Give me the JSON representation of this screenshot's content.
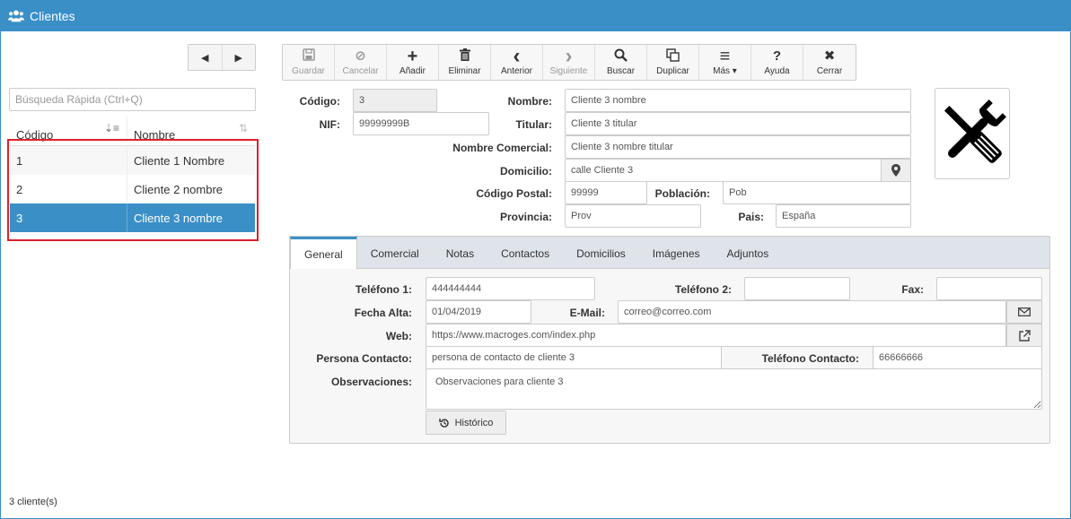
{
  "window": {
    "title": "Clientes",
    "icon": "users-icon"
  },
  "nav": {
    "prev_icon": "◀",
    "next_icon": "▶"
  },
  "search": {
    "placeholder": "Búsqueda Rápida (Ctrl+Q)",
    "value": ""
  },
  "grid": {
    "columns": [
      "Código",
      "Nombre"
    ],
    "rows": [
      {
        "codigo": "1",
        "nombre": "Cliente 1 Nombre"
      },
      {
        "codigo": "2",
        "nombre": "Cliente 2 nombre"
      },
      {
        "codigo": "3",
        "nombre": "Cliente 3 nombre"
      }
    ],
    "selected_row": "3"
  },
  "footer": {
    "count": "3 cliente(s)"
  },
  "toolbar": {
    "buttons": [
      {
        "label": "Guardar",
        "icon": "save-icon",
        "glyph": "🖫",
        "enabled": false
      },
      {
        "label": "Cancelar",
        "icon": "cancel-icon",
        "glyph": "⊘",
        "enabled": false
      },
      {
        "label": "Añadir",
        "icon": "plus-icon",
        "glyph": "+",
        "enabled": true
      },
      {
        "label": "Eliminar",
        "icon": "trash-icon",
        "glyph": "🗑",
        "enabled": true
      },
      {
        "label": "Anterior",
        "icon": "chevron-left-icon",
        "glyph": "‹",
        "enabled": true
      },
      {
        "label": "Siguiente",
        "icon": "chevron-right-icon",
        "glyph": "›",
        "enabled": false
      },
      {
        "label": "Buscar",
        "icon": "search-icon",
        "glyph": "⚲",
        "enabled": true
      },
      {
        "label": "Duplicar",
        "icon": "duplicate-icon",
        "glyph": "❐",
        "enabled": true
      },
      {
        "label": "Más ▾",
        "icon": "menu-icon",
        "glyph": "≡",
        "enabled": true
      },
      {
        "label": "Ayuda",
        "icon": "help-icon",
        "glyph": "?",
        "enabled": true
      },
      {
        "label": "Cerrar",
        "icon": "close-icon",
        "glyph": "✖",
        "enabled": true
      }
    ]
  },
  "form": {
    "codigo": {
      "label": "Código:",
      "value": "3"
    },
    "nif": {
      "label": "NIF:",
      "value": "99999999B"
    },
    "nombre": {
      "label": "Nombre:",
      "value": "Cliente 3 nombre"
    },
    "titular": {
      "label": "Titular:",
      "value": "Cliente 3 titular"
    },
    "nombre_comercial": {
      "label": "Nombre Comercial:",
      "value": "Cliente 3 nombre titular"
    },
    "domicilio": {
      "label": "Domicilio:",
      "value": "calle Cliente 3"
    },
    "codigo_postal": {
      "label": "Código Postal:",
      "value": "99999"
    },
    "poblacion": {
      "label": "Población:",
      "value": "Pob"
    },
    "provincia": {
      "label": "Provincia:",
      "value": "Prov"
    },
    "pais": {
      "label": "Pais:",
      "value": "España"
    }
  },
  "tabs": {
    "items": [
      "General",
      "Comercial",
      "Notas",
      "Contactos",
      "Domicilios",
      "Imágenes",
      "Adjuntos"
    ],
    "active": "General"
  },
  "general": {
    "telefono1": {
      "label": "Teléfono 1:",
      "value": "444444444"
    },
    "telefono2": {
      "label": "Teléfono 2:",
      "value": ""
    },
    "fax": {
      "label": "Fax:",
      "value": ""
    },
    "fecha_alta": {
      "label": "Fecha Alta:",
      "value": "01/04/2019"
    },
    "email": {
      "label": "E-Mail:",
      "value": "correo@correo.com"
    },
    "web": {
      "label": "Web:",
      "value": "https://www.macroges.com/index.php"
    },
    "persona_contacto": {
      "label": "Persona Contacto:",
      "value": "persona de contacto de cliente 3"
    },
    "telefono_contacto": {
      "label": "Teléfono Contacto:",
      "value": "66666666"
    },
    "observaciones": {
      "label": "Observaciones:",
      "value": "Observaciones para cliente 3"
    },
    "historico_label": "Histórico"
  },
  "colors": {
    "accent": "#3a8fc7",
    "highlight_border": "#e0202a"
  }
}
